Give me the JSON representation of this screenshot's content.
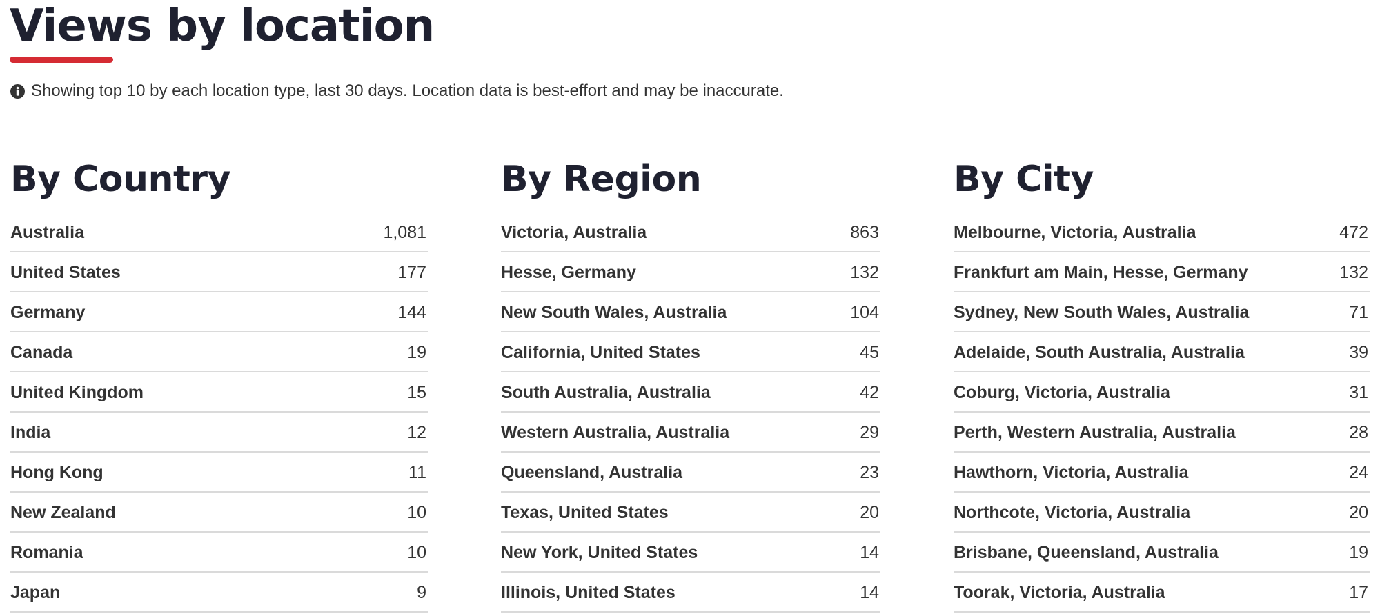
{
  "page": {
    "title": "Views by location",
    "info": "Showing top 10 by each location type, last 30 days. Location data is best-effort and may be inaccurate.",
    "info_icon": "info-circle-icon",
    "accent_color": "#d52b33"
  },
  "sections": [
    {
      "heading": "By Country",
      "rows": [
        {
          "name": "Australia",
          "count": "1,081"
        },
        {
          "name": "United States",
          "count": "177"
        },
        {
          "name": "Germany",
          "count": "144"
        },
        {
          "name": "Canada",
          "count": "19"
        },
        {
          "name": "United Kingdom",
          "count": "15"
        },
        {
          "name": "India",
          "count": "12"
        },
        {
          "name": "Hong Kong",
          "count": "11"
        },
        {
          "name": "New Zealand",
          "count": "10"
        },
        {
          "name": "Romania",
          "count": "10"
        },
        {
          "name": "Japan",
          "count": "9"
        }
      ]
    },
    {
      "heading": "By Region",
      "rows": [
        {
          "name": "Victoria, Australia",
          "count": "863"
        },
        {
          "name": "Hesse, Germany",
          "count": "132"
        },
        {
          "name": "New South Wales, Australia",
          "count": "104"
        },
        {
          "name": "California, United States",
          "count": "45"
        },
        {
          "name": "South Australia, Australia",
          "count": "42"
        },
        {
          "name": "Western Australia, Australia",
          "count": "29"
        },
        {
          "name": "Queensland, Australia",
          "count": "23"
        },
        {
          "name": "Texas, United States",
          "count": "20"
        },
        {
          "name": "New York, United States",
          "count": "14"
        },
        {
          "name": "Illinois, United States",
          "count": "14"
        }
      ]
    },
    {
      "heading": "By City",
      "rows": [
        {
          "name": "Melbourne, Victoria, Australia",
          "count": "472"
        },
        {
          "name": "Frankfurt am Main, Hesse, Germany",
          "count": "132"
        },
        {
          "name": "Sydney, New South Wales, Australia",
          "count": "71"
        },
        {
          "name": "Adelaide, South Australia, Australia",
          "count": "39"
        },
        {
          "name": "Coburg, Victoria, Australia",
          "count": "31"
        },
        {
          "name": "Perth, Western Australia, Australia",
          "count": "28"
        },
        {
          "name": "Hawthorn, Victoria, Australia",
          "count": "24"
        },
        {
          "name": "Northcote, Victoria, Australia",
          "count": "20"
        },
        {
          "name": "Brisbane, Queensland, Australia",
          "count": "19"
        },
        {
          "name": "Toorak, Victoria, Australia",
          "count": "17"
        }
      ]
    }
  ]
}
